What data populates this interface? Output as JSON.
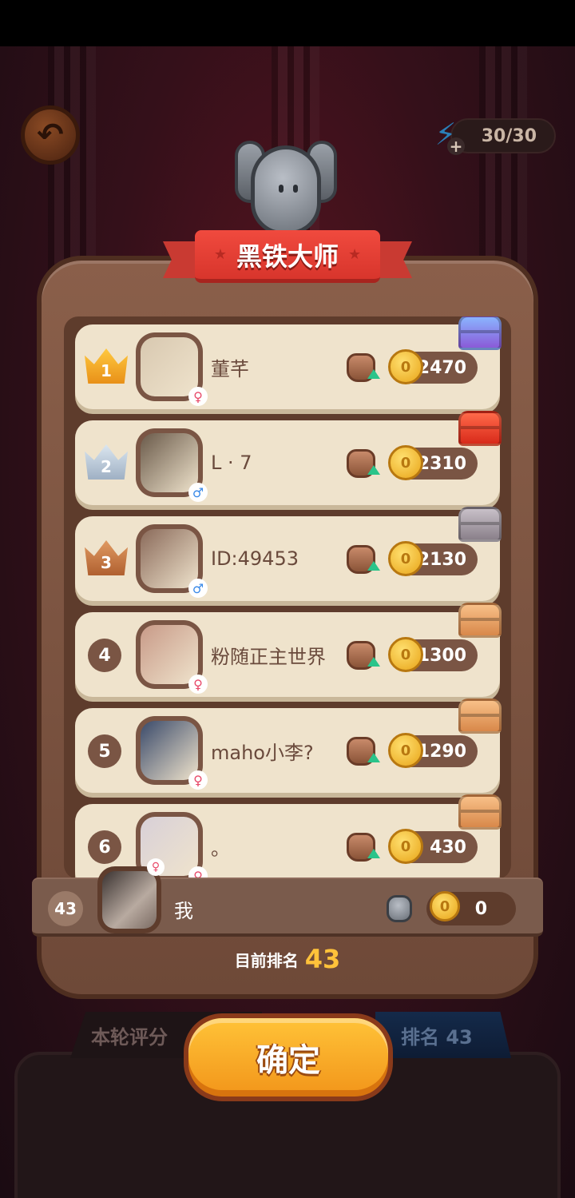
{
  "energy": {
    "text": "30/30"
  },
  "title": "黑铁大师",
  "players": [
    {
      "rank": "1",
      "name": "董芊",
      "gender": "♀",
      "coins": "2470",
      "crown": "gold",
      "chest": "purple",
      "avatar_color": "#d8c8b0"
    },
    {
      "rank": "2",
      "name": "L · 7",
      "gender": "♂",
      "coins": "2310",
      "crown": "silver",
      "chest": "red",
      "avatar_color": "#6a5a4a"
    },
    {
      "rank": "3",
      "name": "ID:49453",
      "gender": "♂",
      "coins": "2130",
      "crown": "bronze",
      "chest": "grey",
      "avatar_color": "#8a6a5a"
    },
    {
      "rank": "4",
      "name": "粉随正主世界",
      "gender": "♀",
      "coins": "1300",
      "crown": "",
      "chest": "orange",
      "avatar_color": "#c89a88"
    },
    {
      "rank": "5",
      "name": "maho小李?",
      "gender": "♀",
      "coins": "1290",
      "crown": "",
      "chest": "orange",
      "avatar_color": "#3a4a6a"
    },
    {
      "rank": "6",
      "name": "。",
      "gender": "♀",
      "coins": "430",
      "crown": "",
      "chest": "orange",
      "avatar_color": "#d8d0d8"
    }
  ],
  "me": {
    "rank": "43",
    "name": "我",
    "gender": "♀",
    "coins": "0"
  },
  "current_rank": {
    "label": "目前排名",
    "value": "43"
  },
  "tabs": {
    "left": "本轮评分",
    "right": "排名 43"
  },
  "confirm_label": "确定",
  "icons": {
    "back": "back-arrow-icon",
    "energy": "lightning-bolt-icon",
    "coin": "gold-coin-icon",
    "badge": "rank-badge-icon",
    "chest": "treasure-chest-icon",
    "crown": "crown-icon"
  }
}
